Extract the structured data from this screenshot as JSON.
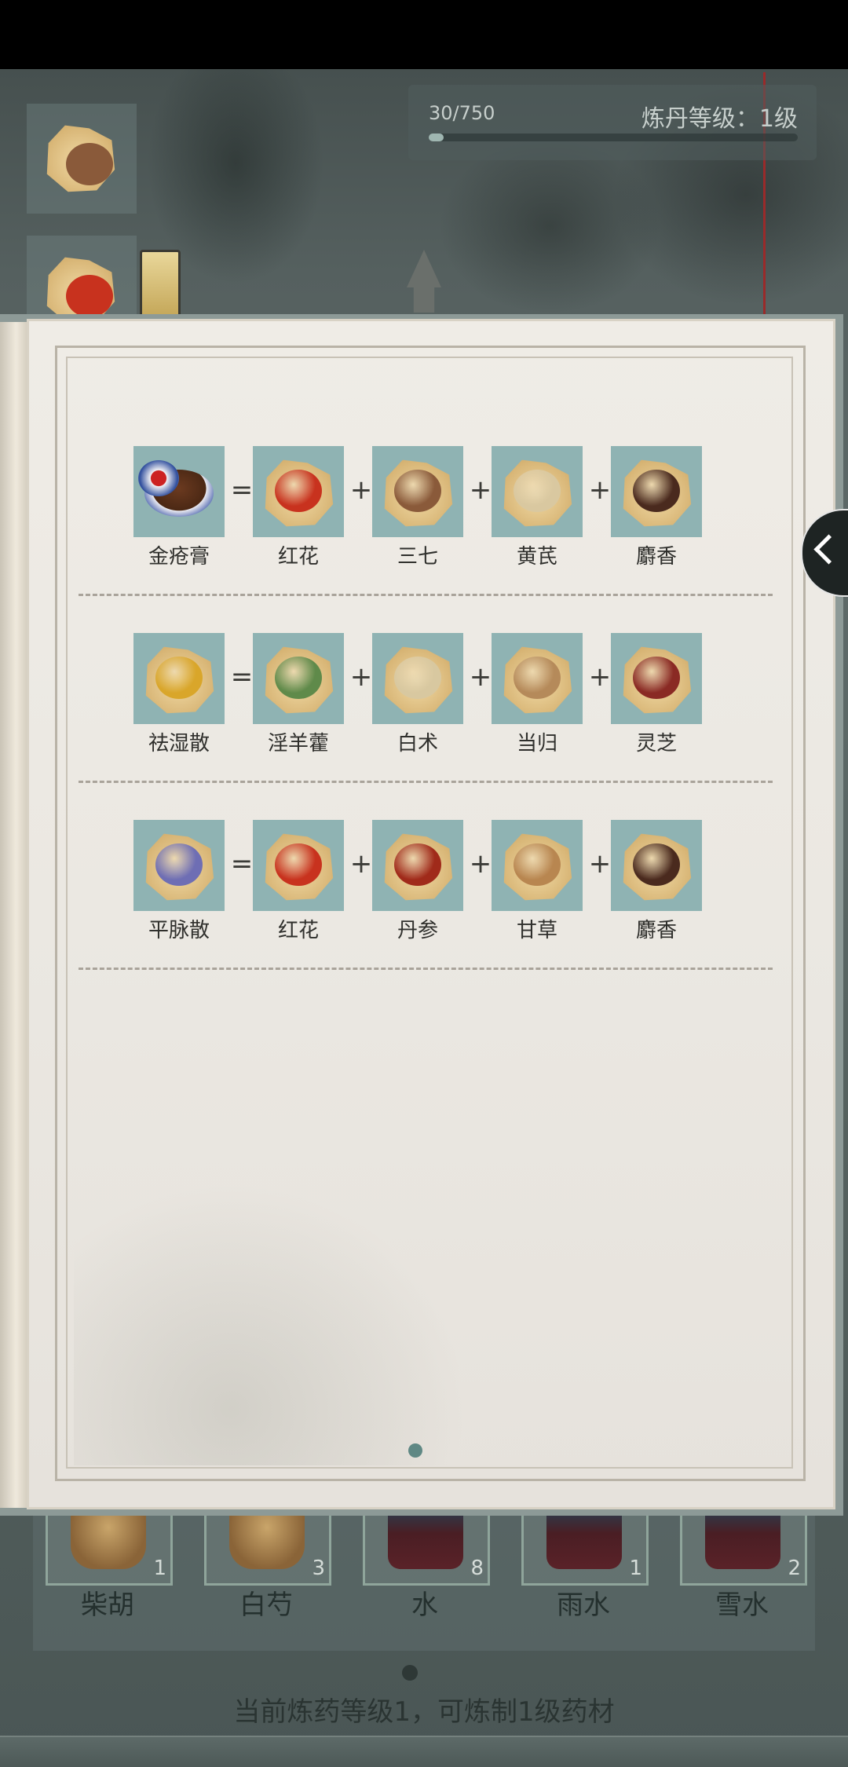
{
  "header": {
    "xp_text": "30/750",
    "xp_progress": 0.04,
    "level_text": "炼丹等级：1级"
  },
  "recipes": [
    {
      "result": {
        "name": "金疮膏",
        "icon": "ointment-jar-icon"
      },
      "ingredients": [
        {
          "name": "红花",
          "color": "#c8321e"
        },
        {
          "name": "三七",
          "color": "#8a5a3a"
        },
        {
          "name": "黄芪",
          "color": "#d9c8a0"
        },
        {
          "name": "麝香",
          "color": "#4a2a1e"
        }
      ]
    },
    {
      "result": {
        "name": "祛湿散",
        "color": "#d9a62a"
      },
      "ingredients": [
        {
          "name": "淫羊藿",
          "color": "#5f8a4a"
        },
        {
          "name": "白术",
          "color": "#d8c8a0"
        },
        {
          "name": "当归",
          "color": "#b58a5a"
        },
        {
          "name": "灵芝",
          "color": "#8a2a24"
        }
      ]
    },
    {
      "result": {
        "name": "平脉散",
        "color": "#6e6eb4"
      },
      "ingredients": [
        {
          "name": "红花",
          "color": "#c8321e"
        },
        {
          "name": "丹参",
          "color": "#a02a1a"
        },
        {
          "name": "甘草",
          "color": "#b88650"
        },
        {
          "name": "麝香",
          "color": "#4a2a1e"
        }
      ]
    }
  ],
  "operators": {
    "equals": "=",
    "plus": "+"
  },
  "inventory": [
    {
      "name": "柴胡",
      "count": "1",
      "kind": "herb"
    },
    {
      "name": "白芍",
      "count": "3",
      "kind": "herb"
    },
    {
      "name": "水",
      "count": "8",
      "kind": "bucket"
    },
    {
      "name": "雨水",
      "count": "1",
      "kind": "bucket"
    },
    {
      "name": "雪水",
      "count": "2",
      "kind": "bucket"
    }
  ],
  "status": "当前炼药等级1，可炼制1级药材",
  "side_recipes": [
    {
      "color": "#8a5a3a"
    },
    {
      "color": "#c8321e"
    }
  ]
}
